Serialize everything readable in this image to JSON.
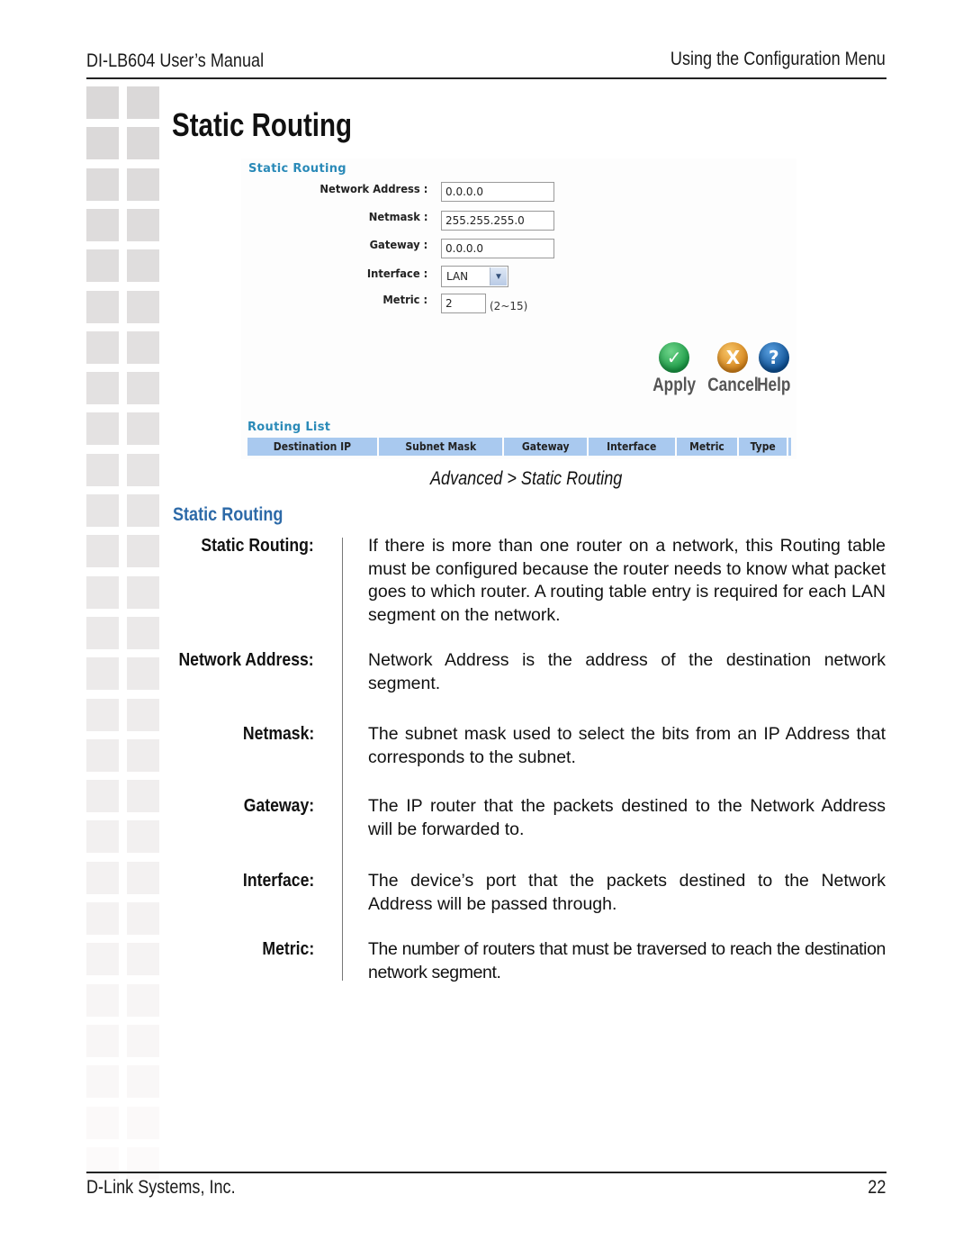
{
  "header": {
    "left": "DI-LB604 User’s Manual",
    "right": "Using the Configuration Menu"
  },
  "page_title": "Static Routing",
  "screenshot": {
    "form_heading": "Static Routing",
    "fields": {
      "network_address": {
        "label": "Network Address :",
        "value": "0.0.0.0"
      },
      "netmask": {
        "label": "Netmask :",
        "value": "255.255.255.0"
      },
      "gateway": {
        "label": "Gateway :",
        "value": "0.0.0.0"
      },
      "interface": {
        "label": "Interface :",
        "selected": "LAN"
      },
      "metric": {
        "label": "Metric :",
        "value": "2",
        "hint": "(2~15)"
      }
    },
    "actions": {
      "apply": {
        "label": "Apply",
        "glyph": "✓",
        "color": "#1a9a45"
      },
      "cancel": {
        "label": "Cancel",
        "glyph": "X",
        "color": "#d6841a"
      },
      "help": {
        "label": "Help",
        "glyph": "?",
        "color": "#0d4f93"
      }
    },
    "routing_list": {
      "heading": "Routing List",
      "columns": [
        "Destination IP",
        "Subnet Mask",
        "Gateway",
        "Interface",
        "Metric",
        "Type"
      ],
      "header_color": "#a9c9ef"
    }
  },
  "caption": "Advanced > Static Routing",
  "section": {
    "heading": "Static Routing",
    "heading_color": "#2d6aa8",
    "definitions": [
      {
        "term": "Static Routing:",
        "description": "If there is more than one router on a network, this Routing table must be configured because the router needs to know what packet goes to which router. A routing table entry is required for each LAN segment on the network."
      },
      {
        "term": "Network Address:",
        "description": "Network Address is the address of the destination network segment."
      },
      {
        "term": "Netmask:",
        "description": "The subnet mask used to select the bits from an IP Address that corresponds to the subnet."
      },
      {
        "term": "Gateway:",
        "description": "The IP router that the packets destined to the Network Address will be forwarded to."
      },
      {
        "term": "Interface:",
        "description": "The device’s port that the packets destined to the Network Address will be passed through."
      },
      {
        "term": "Metric:",
        "description": "The number of routers that must be traversed to reach the destination network segment."
      }
    ]
  },
  "footer": {
    "left": "D-Link Systems, Inc.",
    "page_number": "22"
  }
}
